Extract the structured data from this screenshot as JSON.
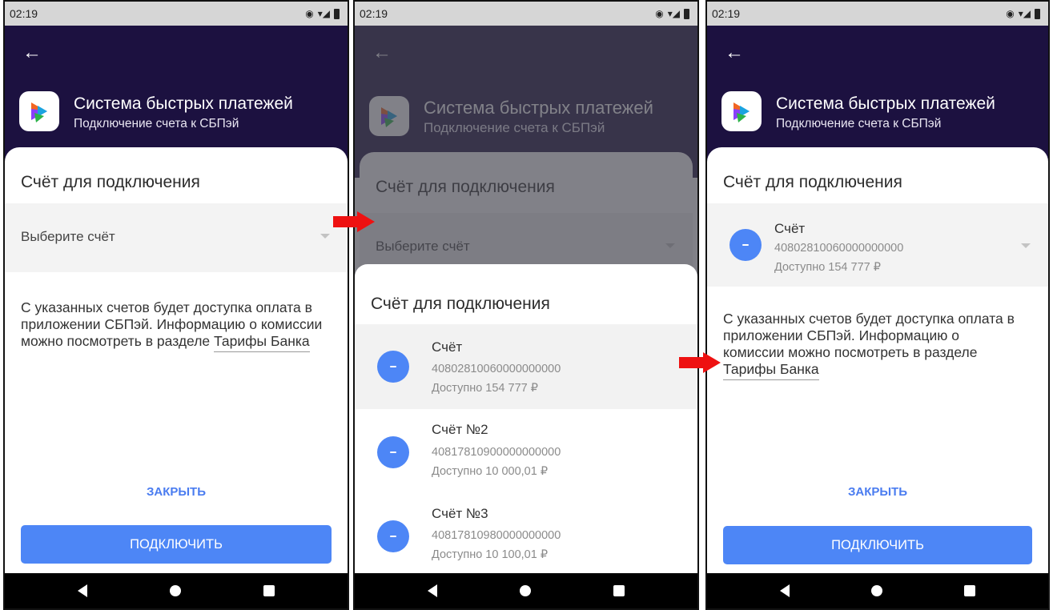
{
  "status": {
    "time": "02:19"
  },
  "header": {
    "title": "Система быстрых платежей",
    "subtitle": "Подключение счета к СБПэй"
  },
  "sheet": {
    "title": "Счёт для подключения",
    "placeholder": "Выберите счёт",
    "info_text": "С указанных счетов будет доступка оплата в приложении СБПэй. Информацию о комиссии можно посмотреть в разделе",
    "info_link": "Тарифы Банка",
    "close_label": "ЗАКРЫТЬ",
    "connect_label": "ПОДКЛЮЧИТЬ"
  },
  "bottom_sheet": {
    "title": "Счёт для подключения",
    "accounts": [
      {
        "name": "Счёт",
        "number": "40802810060000000000",
        "available": "Доступно 154 777 ₽"
      },
      {
        "name": "Счёт №2",
        "number": "40817810900000000000",
        "available": "Доступно 10 000,01 ₽"
      },
      {
        "name": "Счёт №3",
        "number": "40817810980000000000",
        "available": "Доступно 10 100,01 ₽"
      }
    ]
  },
  "selected_account": {
    "name": "Счёт",
    "number": "40802810060000000000",
    "available": "Доступно 154 777 ₽"
  },
  "colors": {
    "header_bg": "#1c1140",
    "accent": "#4d86f6",
    "arrow": "#ee1111"
  },
  "icons": [
    "arrow-left-icon",
    "sbp-logo-icon",
    "account-icon",
    "caret-down-icon",
    "nav-back-icon",
    "nav-home-icon",
    "nav-recent-icon"
  ]
}
